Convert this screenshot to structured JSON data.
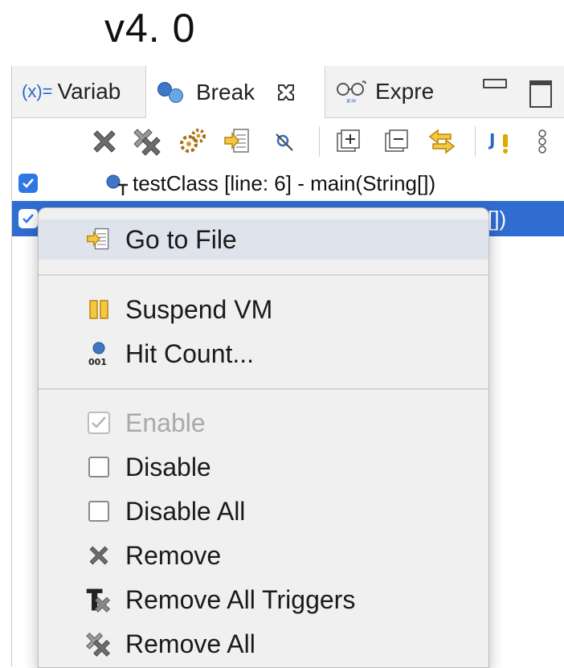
{
  "version_label": "v4. 0",
  "tabs": [
    {
      "label": "Variab",
      "icon": "variables-icon",
      "icon_text": "(x)="
    },
    {
      "label": "Break",
      "icon": "breakpoints-icon",
      "active": true
    },
    {
      "label": "Expre",
      "icon": "expressions-icon"
    }
  ],
  "toolbar": {
    "icons": [
      "remove-icon",
      "remove-all-icon",
      "skip-all-icon",
      "go-to-file-icon",
      "link-icon",
      "expand-all-icon",
      "collapse-all-icon",
      "link-with-debug-icon",
      "java-exception-icon",
      "view-menu-icon"
    ]
  },
  "breakpoints": [
    {
      "label": "testClass [line: 6] - main(String[])",
      "checked": true
    },
    {
      "label": "[])",
      "checked": true,
      "selected": true
    }
  ],
  "context_menu": {
    "go_to_file": "Go to File",
    "suspend_vm": "Suspend VM",
    "hit_count": "Hit Count...",
    "hit_count_icon_text": "001",
    "enable": "Enable",
    "disable": "Disable",
    "disable_all": "Disable All",
    "remove": "Remove",
    "remove_all_triggers": "Remove All Triggers",
    "remove_all": "Remove All"
  },
  "colors": {
    "selection": "#2f6dd0",
    "menu_bg": "#f0f0f0",
    "menu_highlight": "#dfe4ec",
    "checkbox": "#2f78e4"
  }
}
